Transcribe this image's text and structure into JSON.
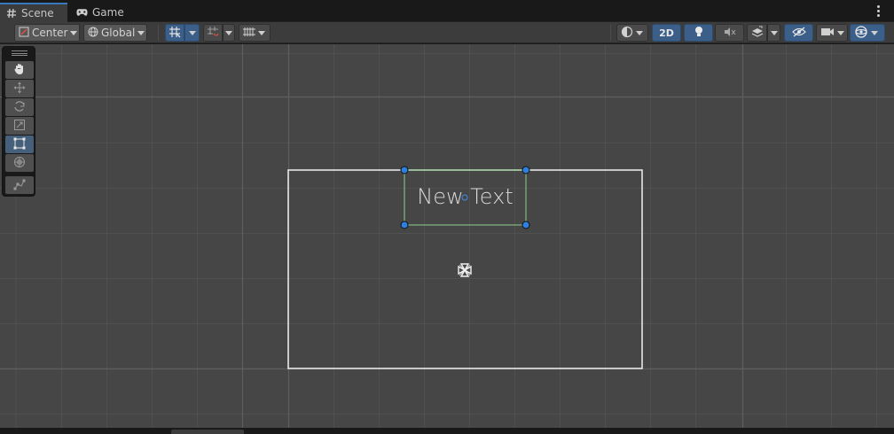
{
  "tabs": [
    {
      "label": "Scene",
      "icon": "hash-grid-icon",
      "active": true
    },
    {
      "label": "Game",
      "icon": "gamepad-icon",
      "active": false
    }
  ],
  "toolbar": {
    "pivot_mode": "Center",
    "pivot_rotation": "Global",
    "view_2d_label": "2D"
  },
  "scene": {
    "text_object_label": "New Text"
  },
  "colors": {
    "accent": "#3a79bb",
    "viewport_bg": "#464646",
    "grid_minor": "#525252",
    "grid_major": "#5c5c5c",
    "canvas_border": "#e8e8e8",
    "rect_border": "#8fcf8f",
    "handle_fill": "#2f7fe0"
  }
}
